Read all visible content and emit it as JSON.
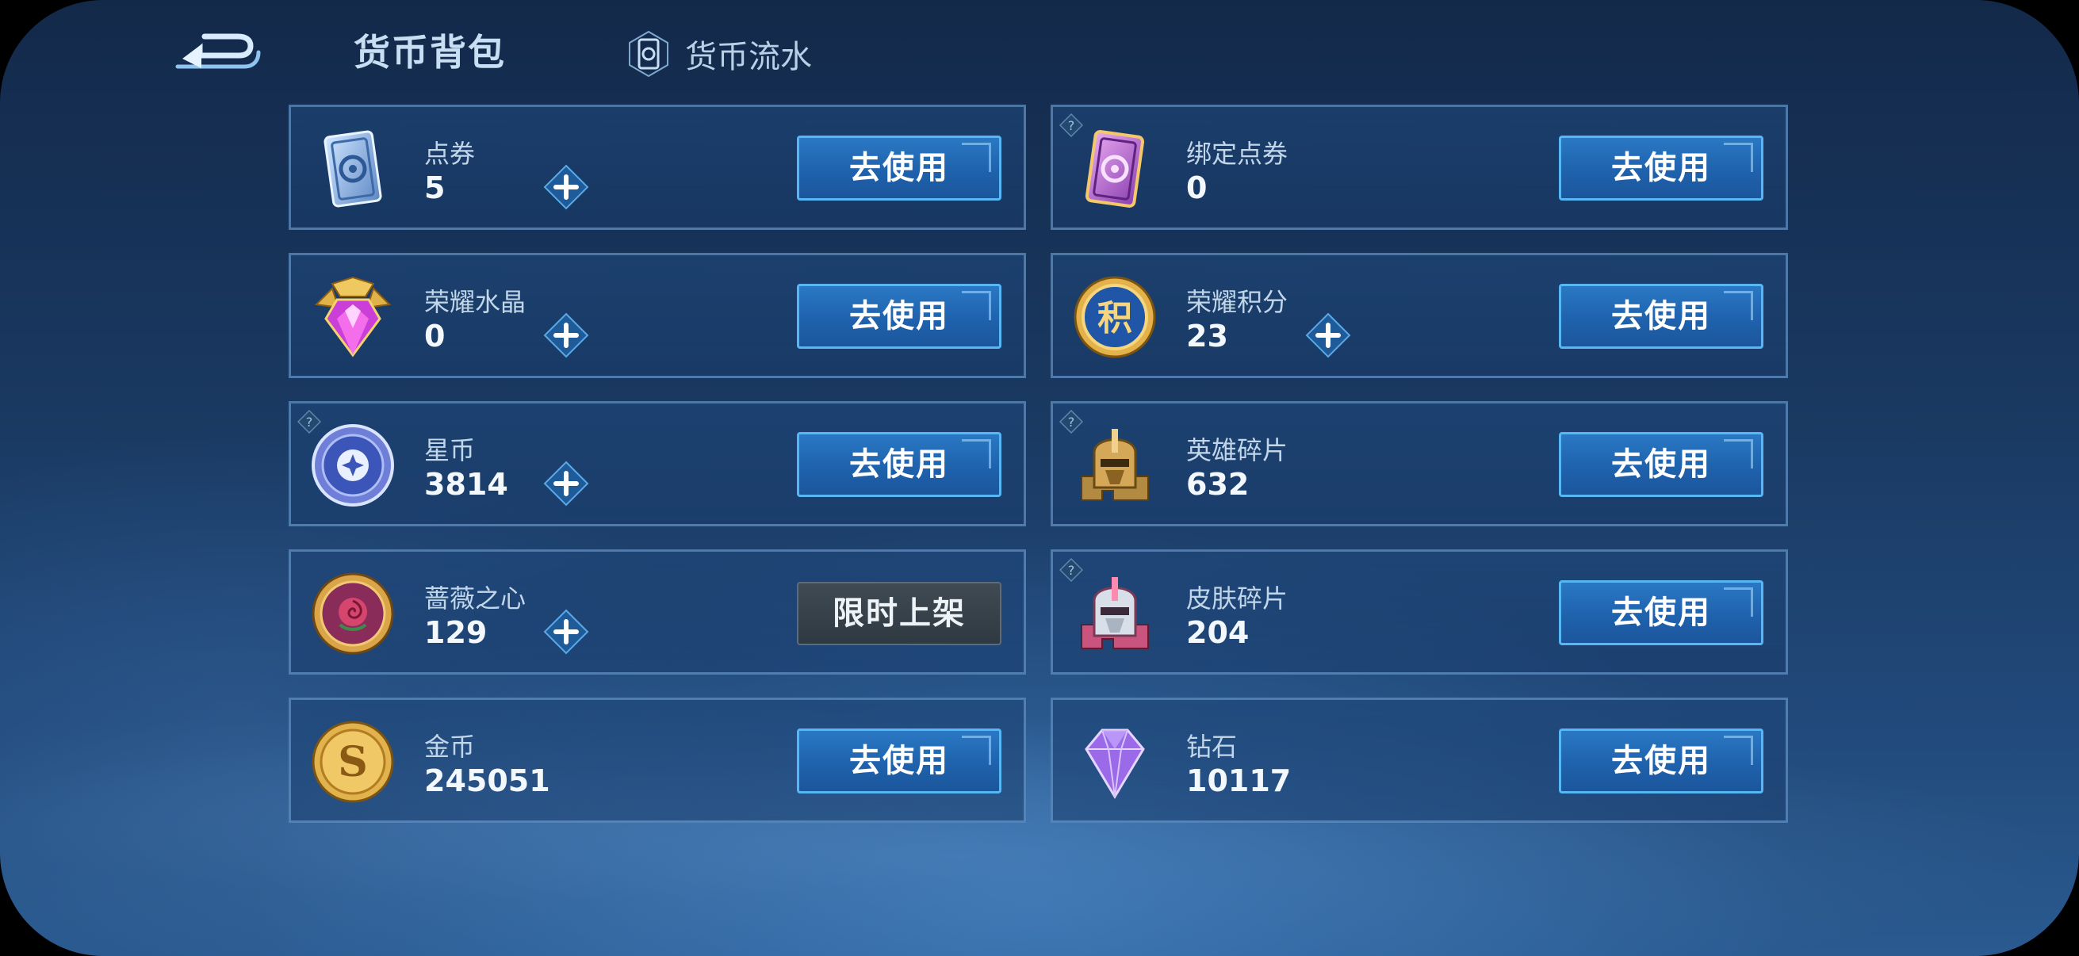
{
  "header": {
    "active_tab": "货币背包",
    "ledger_tab": "货币流水",
    "back_icon": "back-arrow-icon",
    "ledger_icon": "coupon-icon"
  },
  "colors": {
    "button_blue": "#1f62ad",
    "button_border": "#57b7f5",
    "limited_gray": "#3a454e",
    "background": "#1a3a63"
  },
  "currencies": [
    {
      "name": "点券",
      "value": "5",
      "button": "去使用",
      "icon": "coupon-icon",
      "has_plus": true,
      "has_help": false
    },
    {
      "name": "绑定点券",
      "value": "0",
      "button": "去使用",
      "icon": "bound-coupon-icon",
      "has_plus": false,
      "has_help": true
    },
    {
      "name": "荣耀水晶",
      "value": "0",
      "button": "去使用",
      "icon": "glory-crystal-icon",
      "has_plus": true,
      "has_help": false
    },
    {
      "name": "荣耀积分",
      "value": "23",
      "button": "去使用",
      "icon": "glory-points-icon",
      "has_plus": true,
      "has_help": false
    },
    {
      "name": "星币",
      "value": "3814",
      "button": "去使用",
      "icon": "star-coin-icon",
      "has_plus": true,
      "has_help": true
    },
    {
      "name": "英雄碎片",
      "value": "632",
      "button": "去使用",
      "icon": "hero-fragment-icon",
      "has_plus": false,
      "has_help": true
    },
    {
      "name": "蔷薇之心",
      "value": "129",
      "button": "限时上架",
      "icon": "rose-heart-icon",
      "has_plus": true,
      "has_help": false
    },
    {
      "name": "皮肤碎片",
      "value": "204",
      "button": "去使用",
      "icon": "skin-fragment-icon",
      "has_plus": false,
      "has_help": true
    },
    {
      "name": "金币",
      "value": "245051",
      "button": "去使用",
      "icon": "gold-coin-icon",
      "has_plus": false,
      "has_help": false
    },
    {
      "name": "钻石",
      "value": "10117",
      "button": "去使用",
      "icon": "diamond-icon",
      "has_plus": false,
      "has_help": false
    }
  ]
}
